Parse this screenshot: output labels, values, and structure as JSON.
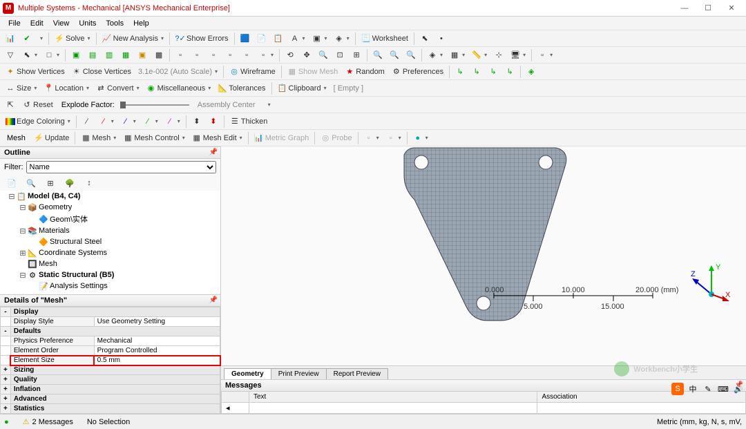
{
  "window": {
    "title": "Multiple Systems - Mechanical [ANSYS Mechanical Enterprise]",
    "app_icon_letter": "M"
  },
  "menubar": [
    "File",
    "Edit",
    "View",
    "Units",
    "Tools",
    "Help"
  ],
  "toolbar1": {
    "solve": "Solve",
    "new_analysis": "New Analysis",
    "show_errors": "Show Errors",
    "worksheet": "Worksheet"
  },
  "toolbar3": {
    "show_vertices": "Show Vertices",
    "close_vertices": "Close Vertices",
    "auto_scale": "3.1e-002 (Auto Scale)",
    "wireframe": "Wireframe",
    "show_mesh": "Show Mesh",
    "random": "Random",
    "preferences": "Preferences"
  },
  "toolbar4": {
    "size": "Size",
    "location": "Location",
    "convert": "Convert",
    "misc": "Miscellaneous",
    "tolerances": "Tolerances",
    "clipboard": "Clipboard",
    "empty": "[ Empty ]"
  },
  "toolbar5": {
    "reset": "Reset",
    "explode_factor": "Explode Factor:",
    "assembly_center": "Assembly Center"
  },
  "toolbar6": {
    "edge_coloring": "Edge Coloring",
    "thicken": "Thicken"
  },
  "toolbar7": {
    "mesh": "Mesh",
    "update": "Update",
    "mesh_menu": "Mesh",
    "mesh_control": "Mesh Control",
    "mesh_edit": "Mesh Edit",
    "metric_graph": "Metric Graph",
    "probe": "Probe"
  },
  "outline": {
    "header": "Outline",
    "filter_label": "Filter:",
    "filter_value": "Name",
    "tree": [
      {
        "indent": 0,
        "exp": "⊟",
        "ico": "📋",
        "label": "Model (B4, C4)",
        "bold": true
      },
      {
        "indent": 1,
        "exp": "⊟",
        "ico": "📦",
        "label": "Geometry"
      },
      {
        "indent": 2,
        "exp": "",
        "ico": "🔷",
        "label": "Geom\\实体"
      },
      {
        "indent": 1,
        "exp": "⊟",
        "ico": "📚",
        "label": "Materials"
      },
      {
        "indent": 2,
        "exp": "",
        "ico": "🔶",
        "label": "Structural Steel"
      },
      {
        "indent": 1,
        "exp": "⊞",
        "ico": "📐",
        "label": "Coordinate Systems"
      },
      {
        "indent": 1,
        "exp": "",
        "ico": "🔲",
        "label": "Mesh"
      },
      {
        "indent": 1,
        "exp": "⊟",
        "ico": "⚙",
        "label": "Static Structural (B5)",
        "bold": true
      },
      {
        "indent": 2,
        "exp": "",
        "ico": "📝",
        "label": "Analysis Settings"
      }
    ]
  },
  "details": {
    "header": "Details of \"Mesh\"",
    "groups": [
      {
        "exp": "-",
        "name": "Display",
        "rows": [
          {
            "label": "Display Style",
            "value": "Use Geometry Setting"
          }
        ]
      },
      {
        "exp": "-",
        "name": "Defaults",
        "rows": [
          {
            "label": "Physics Preference",
            "value": "Mechanical"
          },
          {
            "label": "Element Order",
            "value": "Program Controlled"
          },
          {
            "label": "Element Size",
            "value": "0.5 mm",
            "highlighted": true
          }
        ]
      },
      {
        "exp": "+",
        "name": "Sizing",
        "rows": []
      },
      {
        "exp": "+",
        "name": "Quality",
        "rows": []
      },
      {
        "exp": "+",
        "name": "Inflation",
        "rows": []
      },
      {
        "exp": "+",
        "name": "Advanced",
        "rows": []
      },
      {
        "exp": "+",
        "name": "Statistics",
        "rows": []
      }
    ]
  },
  "viewport": {
    "scale": {
      "major_left": "0.000",
      "major_mid": "10.000",
      "major_right": "20.000 (mm)",
      "minor_left": "5.000",
      "minor_right": "15.000"
    },
    "tabs": [
      "Geometry",
      "Print Preview",
      "Report Preview"
    ],
    "active_tab": 0,
    "axes": {
      "z": "Z",
      "y": "Y",
      "x": "X"
    }
  },
  "messages": {
    "header": "Messages",
    "columns": [
      "",
      "Text",
      "Association"
    ]
  },
  "statusbar": {
    "msg_count": "2 Messages",
    "selection": "No Selection",
    "units": "Metric (mm, kg, N, s, mV,"
  },
  "watermark": "Workbench小学生",
  "right_icons": [
    "S",
    "中",
    "✎",
    "⌨",
    "🔊"
  ]
}
